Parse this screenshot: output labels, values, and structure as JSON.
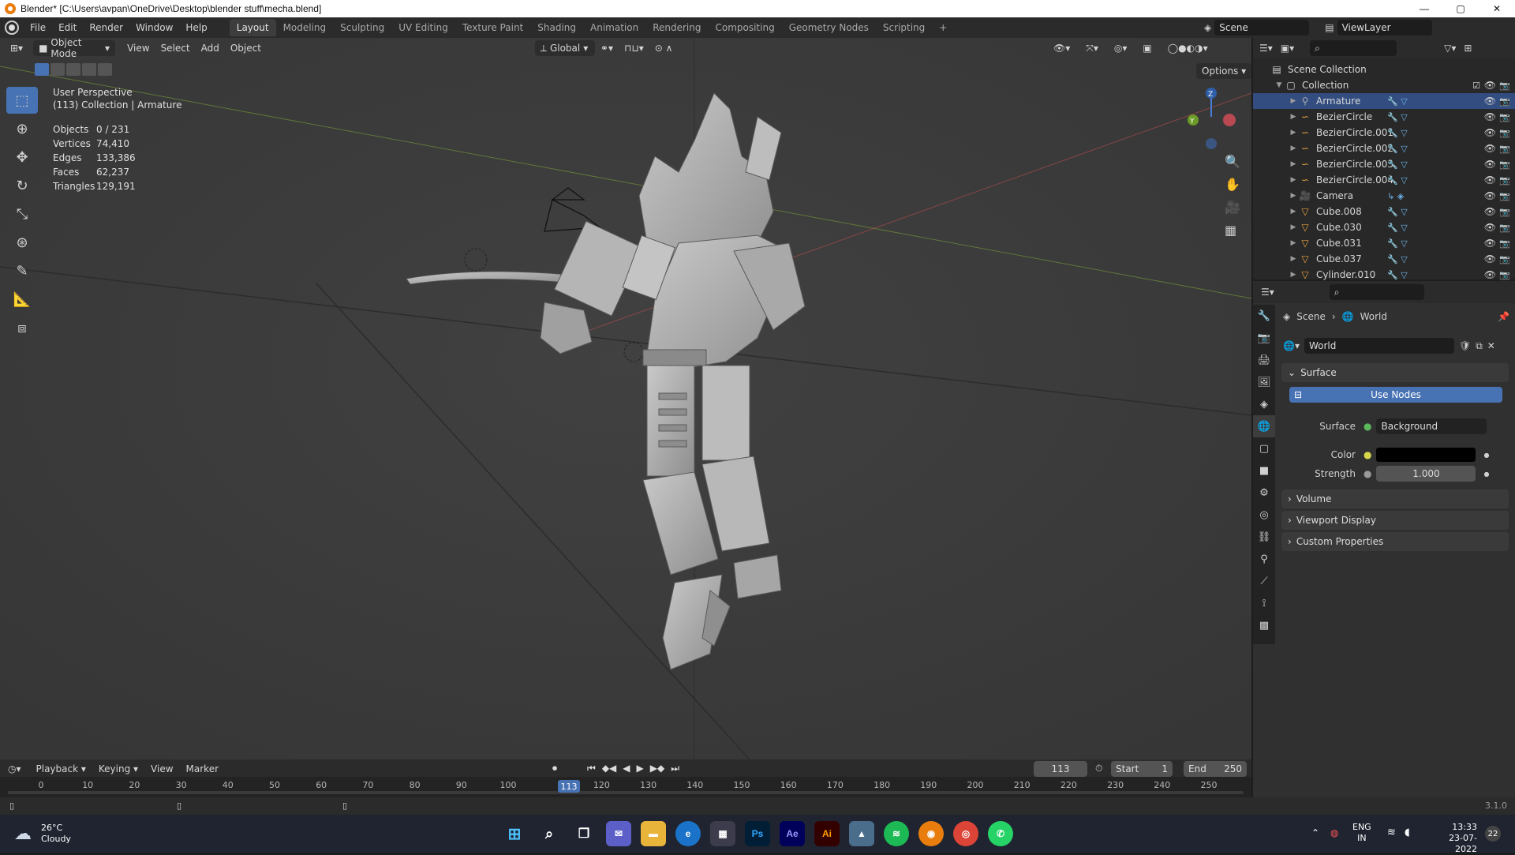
{
  "window": {
    "title": "Blender* [C:\\Users\\avpan\\OneDrive\\Desktop\\blender stuff\\mecha.blend]",
    "controls": [
      "—",
      "▢",
      "✕"
    ]
  },
  "menu": {
    "items": [
      "File",
      "Edit",
      "Render",
      "Window",
      "Help"
    ],
    "workspaces": [
      "Layout",
      "Modeling",
      "Sculpting",
      "UV Editing",
      "Texture Paint",
      "Shading",
      "Animation",
      "Rendering",
      "Compositing",
      "Geometry Nodes",
      "Scripting"
    ],
    "add_tab": "+",
    "scene": "Scene",
    "view_layer": "ViewLayer"
  },
  "viewport": {
    "mode": "Object Mode",
    "menus": [
      "View",
      "Select",
      "Add",
      "Object"
    ],
    "orientation": "Global",
    "options": "Options",
    "perspective": "User Perspective",
    "collection_info": "(113) Collection | Armature",
    "stats": [
      {
        "label": "Objects",
        "value": "0 / 231"
      },
      {
        "label": "Vertices",
        "value": "74,410"
      },
      {
        "label": "Edges",
        "value": "133,386"
      },
      {
        "label": "Faces",
        "value": "62,237"
      },
      {
        "label": "Triangles",
        "value": "129,191"
      }
    ],
    "gizmo": {
      "z": "Z",
      "y": "Y"
    }
  },
  "outliner": {
    "root": "Scene Collection",
    "collection": "Collection",
    "items": [
      {
        "name": "Armature",
        "selected": true
      },
      {
        "name": "BezierCircle",
        "selected": false
      },
      {
        "name": "BezierCircle.001",
        "selected": false
      },
      {
        "name": "BezierCircle.002",
        "selected": false
      },
      {
        "name": "BezierCircle.003",
        "selected": false
      },
      {
        "name": "BezierCircle.004",
        "selected": false
      },
      {
        "name": "Camera",
        "selected": false
      },
      {
        "name": "Cube.008",
        "selected": false
      },
      {
        "name": "Cube.030",
        "selected": false
      },
      {
        "name": "Cube.031",
        "selected": false
      },
      {
        "name": "Cube.037",
        "selected": false
      },
      {
        "name": "Cylinder.010",
        "selected": false
      }
    ]
  },
  "properties": {
    "breadcrumb": [
      "Scene",
      "World"
    ],
    "world_name": "World",
    "surface_panel": "Surface",
    "use_nodes": "Use Nodes",
    "surface_label": "Surface",
    "surface_value": "Background",
    "color_label": "Color",
    "strength_label": "Strength",
    "strength_value": "1.000",
    "collapsed_panels": [
      "Volume",
      "Viewport Display",
      "Custom Properties"
    ],
    "colors": {
      "accent": "#4772b3",
      "world_color": "#000000"
    }
  },
  "timeline": {
    "menus": [
      "Playback",
      "Keying",
      "View",
      "Marker"
    ],
    "current_frame": "113",
    "start_label": "Start",
    "start_value": "1",
    "end_label": "End",
    "end_value": "250",
    "ticks": [
      "0",
      "10",
      "20",
      "30",
      "40",
      "50",
      "60",
      "70",
      "80",
      "90",
      "100",
      "11",
      "113",
      "120",
      "130",
      "140",
      "150",
      "160",
      "170",
      "180",
      "190",
      "200",
      "210",
      "220",
      "230",
      "240",
      "250"
    ],
    "version": "3.1.0"
  },
  "taskbar": {
    "weather_temp": "26°C",
    "weather_desc": "Cloudy",
    "lang1": "ENG",
    "lang2": "IN",
    "time": "13:33",
    "date": "23-07-2022",
    "notifications": "22",
    "apps": [
      "Ps",
      "Ae",
      "Ai"
    ]
  }
}
